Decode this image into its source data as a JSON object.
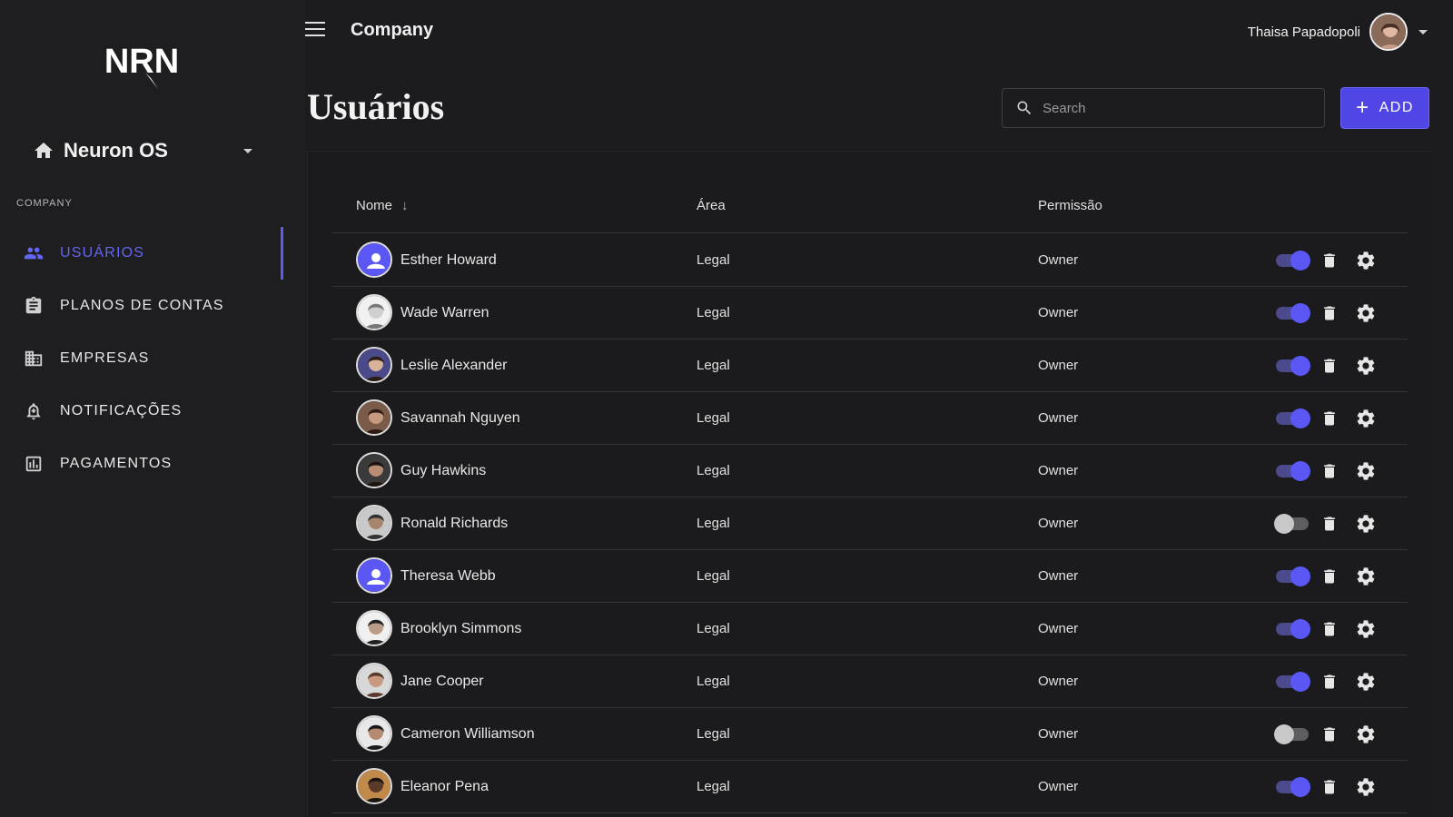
{
  "app": {
    "workspace": "Neuron OS",
    "section_label": "COMPANY",
    "header_title": "Company"
  },
  "user": {
    "name": "Thaisa Papadopoli"
  },
  "nav": [
    {
      "label": "USUÁRIOS",
      "icon": "users-icon",
      "active": true
    },
    {
      "label": "PLANOS DE CONTAS",
      "icon": "clipboard-icon",
      "active": false
    },
    {
      "label": "EMPRESAS",
      "icon": "building-icon",
      "active": false
    },
    {
      "label": "NOTIFICAÇÕES",
      "icon": "bell-icon",
      "active": false
    },
    {
      "label": "PAGAMENTOS",
      "icon": "chart-icon",
      "active": false
    }
  ],
  "page": {
    "title": "Usuários"
  },
  "search": {
    "placeholder": "Search"
  },
  "add_button": {
    "label": "ADD"
  },
  "table": {
    "headers": {
      "name": "Nome",
      "area": "Área",
      "permission": "Permissão"
    },
    "rows": [
      {
        "name": "Esther Howard",
        "area": "Legal",
        "permission": "Owner",
        "enabled": true,
        "avatar": "placeholder"
      },
      {
        "name": "Wade Warren",
        "area": "Legal",
        "permission": "Owner",
        "enabled": true,
        "avatar": "photo"
      },
      {
        "name": "Leslie Alexander",
        "area": "Legal",
        "permission": "Owner",
        "enabled": true,
        "avatar": "photo"
      },
      {
        "name": "Savannah Nguyen",
        "area": "Legal",
        "permission": "Owner",
        "enabled": true,
        "avatar": "photo"
      },
      {
        "name": "Guy Hawkins",
        "area": "Legal",
        "permission": "Owner",
        "enabled": true,
        "avatar": "photo"
      },
      {
        "name": "Ronald Richards",
        "area": "Legal",
        "permission": "Owner",
        "enabled": false,
        "avatar": "photo"
      },
      {
        "name": "Theresa Webb",
        "area": "Legal",
        "permission": "Owner",
        "enabled": true,
        "avatar": "placeholder"
      },
      {
        "name": "Brooklyn Simmons",
        "area": "Legal",
        "permission": "Owner",
        "enabled": true,
        "avatar": "photo"
      },
      {
        "name": "Jane Cooper",
        "area": "Legal",
        "permission": "Owner",
        "enabled": true,
        "avatar": "photo"
      },
      {
        "name": "Cameron Williamson",
        "area": "Legal",
        "permission": "Owner",
        "enabled": false,
        "avatar": "photo"
      },
      {
        "name": "Eleanor Pena",
        "area": "Legal",
        "permission": "Owner",
        "enabled": true,
        "avatar": "photo"
      }
    ]
  },
  "colors": {
    "accent": "#5b57f5",
    "background": "#1c1c1e",
    "toggle_off": "#c8c8c8"
  }
}
